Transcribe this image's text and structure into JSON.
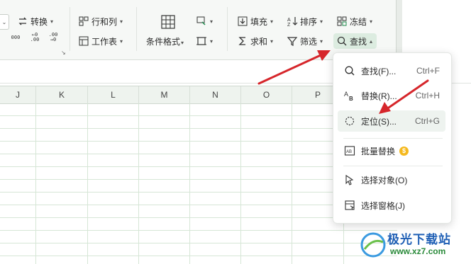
{
  "ribbon": {
    "convert_label": "转换",
    "rows_cols_label": "行和列",
    "worksheet_label": "工作表",
    "cond_format_label": "条件格式",
    "fill_label": "填充",
    "sum_label": "求和",
    "sort_label": "排序",
    "filter_label": "筛选",
    "freeze_label": "冻结",
    "find_label": "查找",
    "num_fmt_1": "000",
    "num_fmt_2": "←0 .00",
    "num_fmt_3": ".00 →0"
  },
  "columns": [
    "J",
    "K",
    "L",
    "M",
    "N",
    "O",
    "P"
  ],
  "find_menu": {
    "items": [
      {
        "label": "查找(F)...",
        "shortcut": "Ctrl+F",
        "icon": "search-icon"
      },
      {
        "label": "替换(R)...",
        "shortcut": "Ctrl+H",
        "icon": "replace-icon"
      },
      {
        "label": "定位(S)...",
        "shortcut": "Ctrl+G",
        "icon": "locate-icon"
      },
      {
        "label": "批量替换",
        "shortcut": "",
        "icon": "batch-replace-icon",
        "badge": "premium-icon"
      },
      {
        "label": "选择对象(O)",
        "shortcut": "",
        "icon": "pointer-icon"
      },
      {
        "label": "选择窗格(J)",
        "shortcut": "",
        "icon": "pane-icon"
      }
    ]
  },
  "watermark": {
    "title": "极光下载站",
    "url": "www.xz7.com"
  },
  "colors": {
    "arrow": "#d6262b",
    "accent_green": "#1f8a4c",
    "highlight": "#dcece0"
  }
}
